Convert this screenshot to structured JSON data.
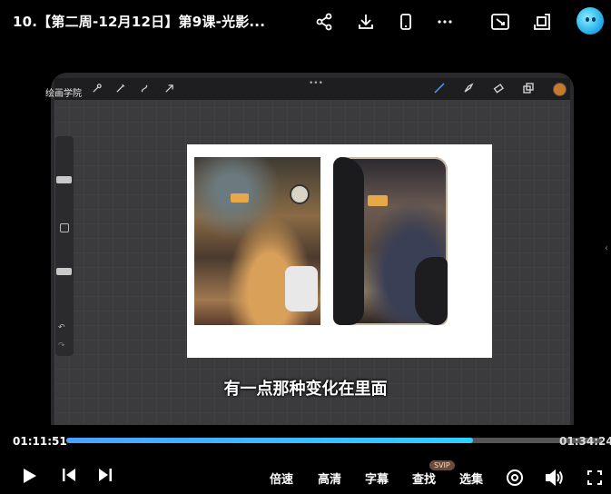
{
  "video": {
    "title": "10.【第二周-12月12日】第9课-光影...",
    "subtitle": "有一点那种变化在里面",
    "watermark": "绘画学院"
  },
  "top_icons": [
    "share-icon",
    "download-icon",
    "phone-icon",
    "more-icon",
    "screen-cast-icon",
    "picture-in-picture-icon",
    "avatar"
  ],
  "playback": {
    "current_time": "01:11:51",
    "total_time": "01:34:24",
    "progress_fraction": 0.76
  },
  "controls": {
    "speed_label": "倍速",
    "quality_label": "高清",
    "caption_label": "字幕",
    "search_label": "查找",
    "search_badge": "SVIP",
    "episodes_label": "选集"
  },
  "colors": {
    "progress": "#2fd0ff",
    "brush_color": "#c87a2a"
  }
}
